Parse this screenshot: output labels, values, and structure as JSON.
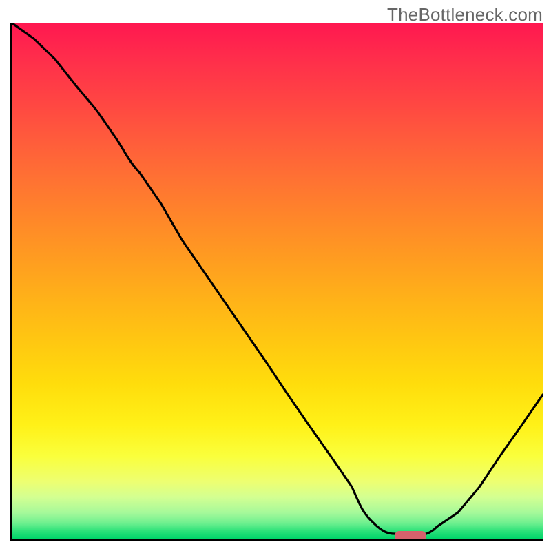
{
  "watermark": "TheBottleneck.com",
  "colors": {
    "gradient_top": "#ff1850",
    "gradient_bottom": "#00d56a",
    "axis": "#000000",
    "curve": "#000000",
    "marker": "#d6616c",
    "watermark": "#666666"
  },
  "chart_data": {
    "type": "line",
    "title": "",
    "xlabel": "",
    "ylabel": "",
    "xlim": [
      0,
      100
    ],
    "ylim": [
      0,
      100
    ],
    "x": [
      0,
      4,
      8,
      12,
      16,
      20,
      22,
      24,
      28,
      32,
      36,
      40,
      44,
      48,
      52,
      56,
      60,
      64,
      66,
      70,
      72,
      74,
      76,
      78,
      80,
      84,
      88,
      92,
      96,
      100
    ],
    "values": [
      100,
      97,
      93,
      88,
      83,
      77,
      74,
      71,
      65,
      58,
      52,
      46,
      40,
      34,
      28,
      22,
      16,
      10,
      6,
      2,
      1,
      0,
      0,
      0,
      1,
      5,
      10,
      16,
      22,
      28
    ],
    "marker": {
      "x_start": 72,
      "x_end": 78,
      "y": 0
    },
    "notes": "y=100 maps to gradient top (red / worst), y=0 maps to gradient bottom (green / best). Values estimated from pixel positions; no numeric tick labels are shown in the source image."
  }
}
